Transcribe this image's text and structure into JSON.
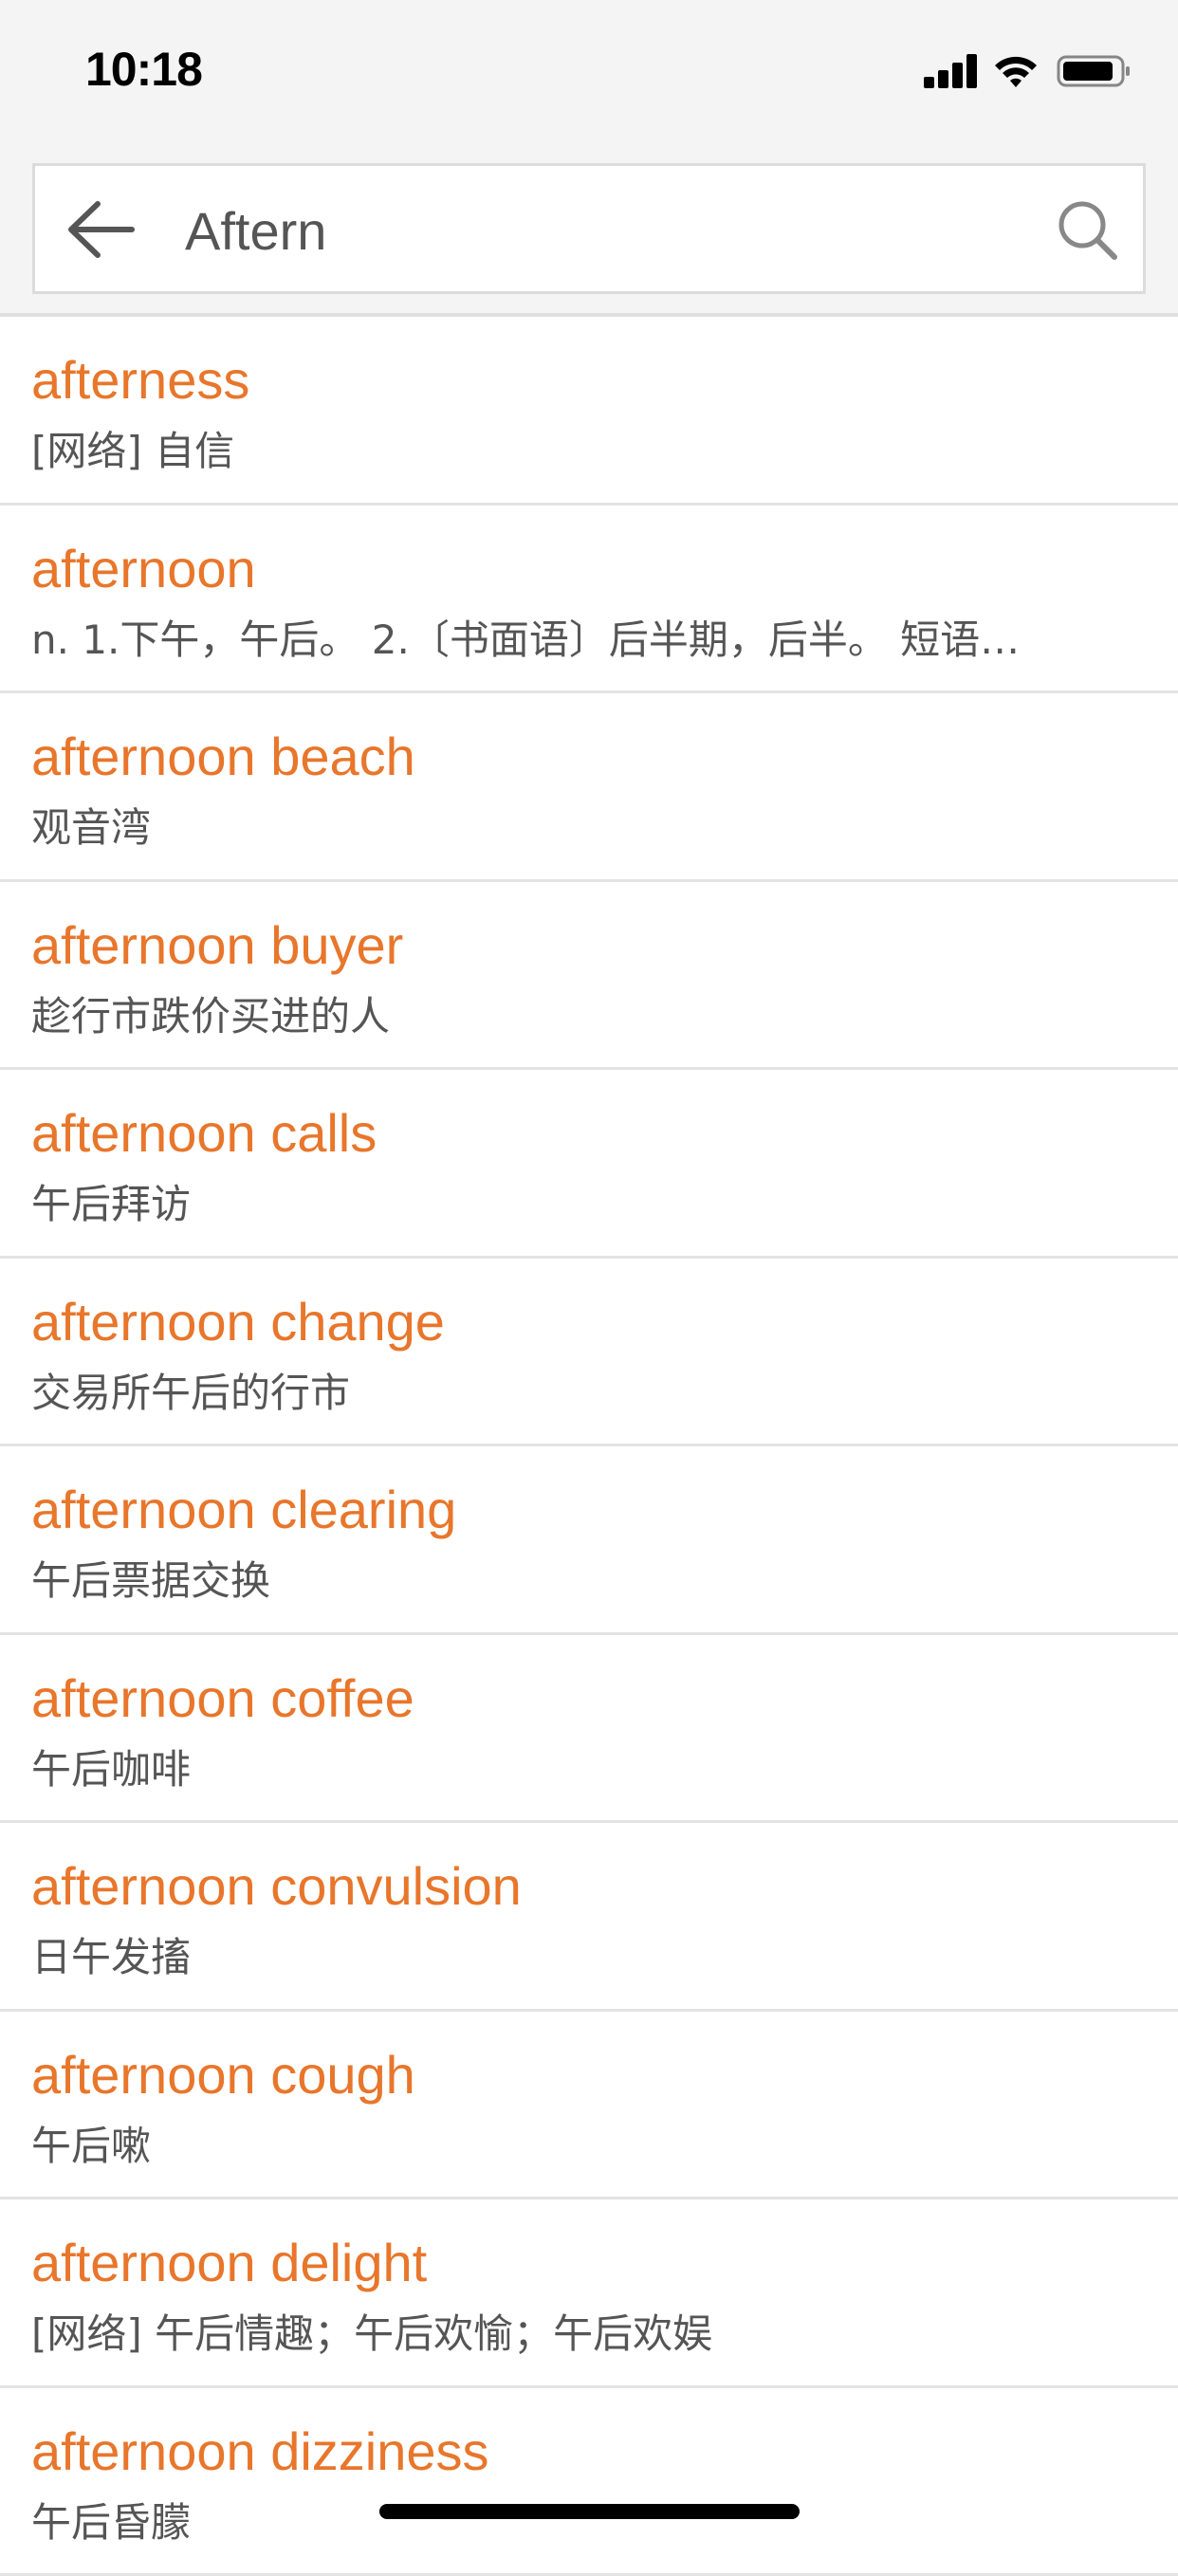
{
  "status_bar": {
    "time": "10:18"
  },
  "search": {
    "value": "Aftern"
  },
  "results": [
    {
      "word": "afterness",
      "meaning": "[网络] 自信"
    },
    {
      "word": "afternoon",
      "meaning": "n. 1.下午，午后。 2.〔书面语〕后半期，后半。 短语…"
    },
    {
      "word": "afternoon beach",
      "meaning": "观音湾"
    },
    {
      "word": "afternoon buyer",
      "meaning": "趁行市跌价买进的人"
    },
    {
      "word": "afternoon calls",
      "meaning": "午后拜访"
    },
    {
      "word": "afternoon change",
      "meaning": "交易所午后的行市"
    },
    {
      "word": "afternoon clearing",
      "meaning": "午后票据交换"
    },
    {
      "word": "afternoon coffee",
      "meaning": "午后咖啡"
    },
    {
      "word": "afternoon convulsion",
      "meaning": "日午发搐"
    },
    {
      "word": "afternoon cough",
      "meaning": "午后嗽"
    },
    {
      "word": "afternoon delight",
      "meaning": "[网络] 午后情趣；午后欢愉；午后欢娱"
    },
    {
      "word": "afternoon dizziness",
      "meaning": "午后昏朦"
    }
  ],
  "colors": {
    "accent": "#e8762b",
    "meaning_text": "#555555",
    "header_bg": "#f4f4f4",
    "divider": "#e3e3e3"
  },
  "icons": {
    "back": "arrow-left-icon",
    "search": "magnifier-icon",
    "signal": "cellular-signal-icon",
    "wifi": "wifi-icon",
    "battery": "battery-icon"
  }
}
